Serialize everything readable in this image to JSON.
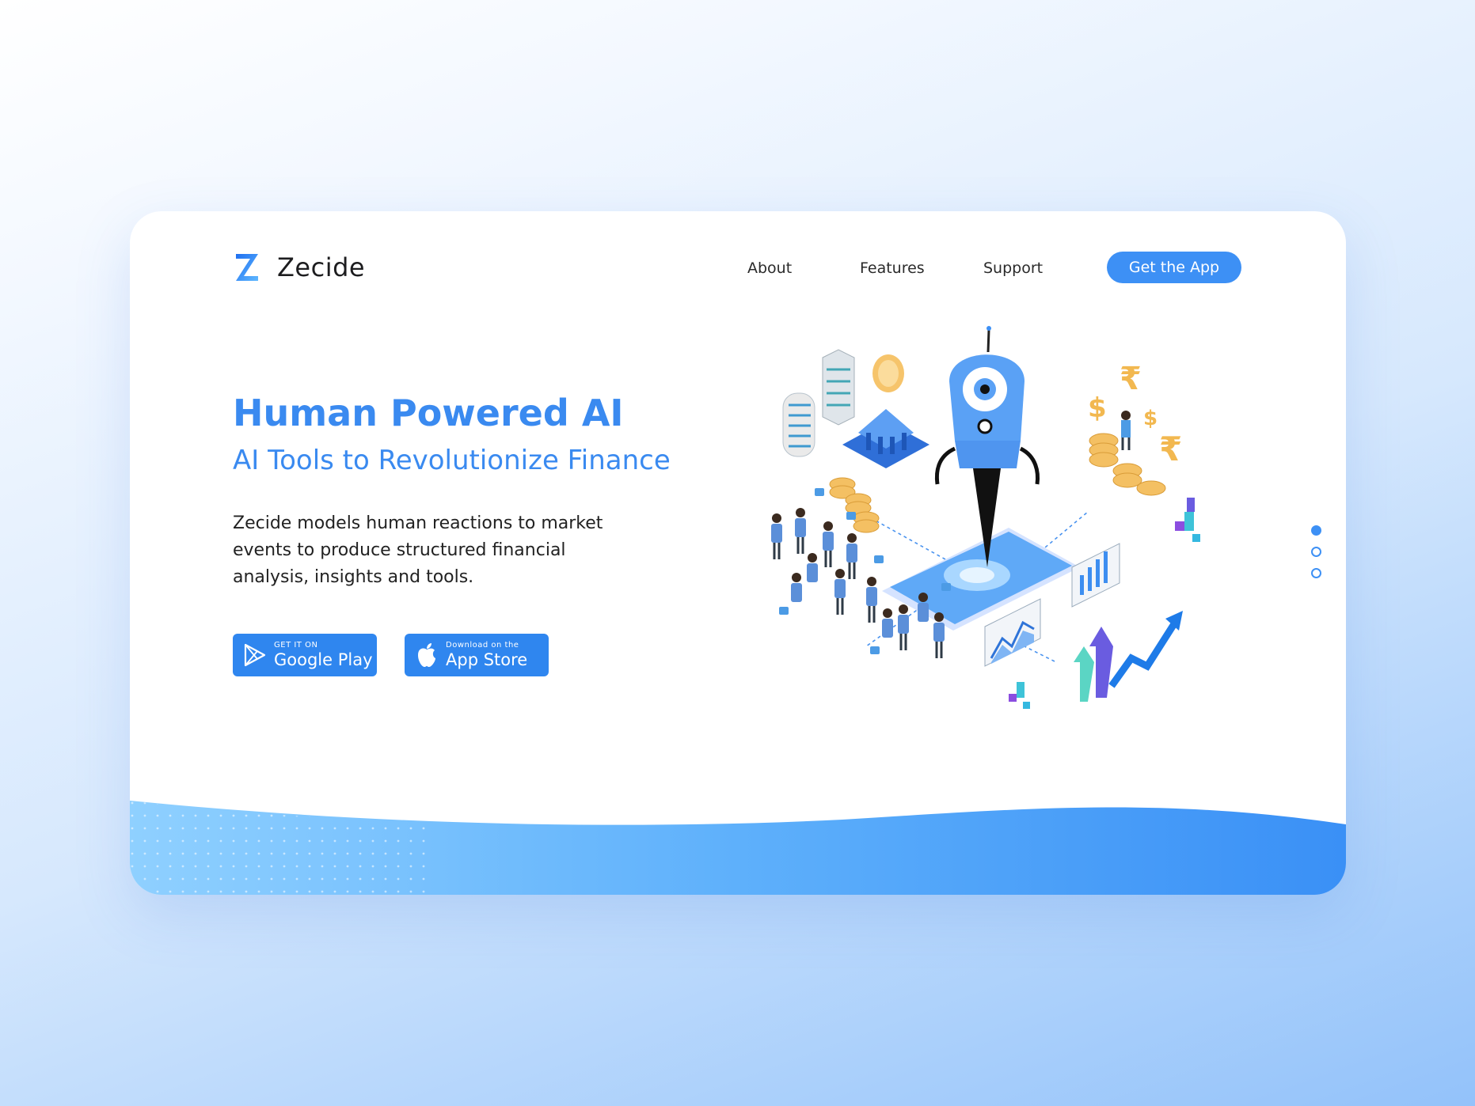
{
  "brand": {
    "name": "Zecide",
    "logo_icon": "z-logo-icon"
  },
  "nav": {
    "about": "About",
    "features": "Features",
    "support": "Support",
    "cta": "Get the App"
  },
  "hero": {
    "title": "Human Powered AI",
    "subtitle": "AI Tools to Revolutionize Finance",
    "description": "Zecide models human reactions to market events to produce structured financial analysis, insights and tools."
  },
  "stores": {
    "google": {
      "small": "GET IT ON",
      "big": "Google Play",
      "icon": "google-play-icon"
    },
    "apple": {
      "small": "Download on the",
      "big": "App Store",
      "icon": "apple-icon"
    }
  },
  "pagination": {
    "count": 3,
    "active_index": 0
  },
  "colors": {
    "accent": "#3d90f5",
    "heading": "#3a8af0",
    "text": "#222222"
  }
}
